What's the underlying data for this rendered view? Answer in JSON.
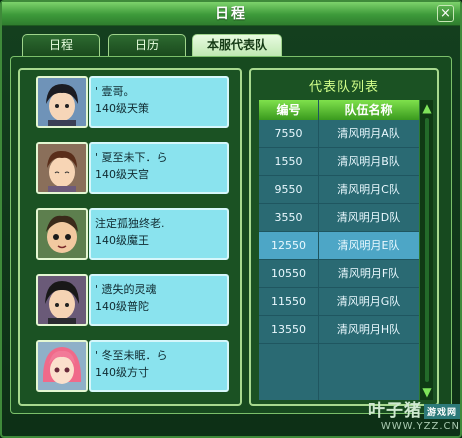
{
  "window": {
    "title": "日程",
    "close_glyph": "×"
  },
  "tabs": [
    {
      "label": "日程",
      "active": false
    },
    {
      "label": "日历",
      "active": false
    },
    {
      "label": "本服代表队",
      "active": true
    }
  ],
  "members": [
    {
      "name": "' 壹哥。",
      "level_class": "140级天策"
    },
    {
      "name": "' 夏至未下．ら",
      "level_class": "140级天宫"
    },
    {
      "name": "注定孤独终老.",
      "level_class": "140级魔王"
    },
    {
      "name": "' 遗失的灵魂",
      "level_class": "140级普陀"
    },
    {
      "name": "' 冬至未眠．ら",
      "level_class": "140级方寸"
    }
  ],
  "team_list": {
    "title": "代表队列表",
    "headers": {
      "id": "编号",
      "name": "队伍名称"
    },
    "rows": [
      {
        "id": "7550",
        "name": "清风明月A队",
        "selected": false
      },
      {
        "id": "1550",
        "name": "清风明月B队",
        "selected": false
      },
      {
        "id": "9550",
        "name": "清风明月C队",
        "selected": false
      },
      {
        "id": "3550",
        "name": "清风明月D队",
        "selected": false
      },
      {
        "id": "12550",
        "name": "清风明月E队",
        "selected": true
      },
      {
        "id": "10550",
        "name": "清风明月F队",
        "selected": false
      },
      {
        "id": "11550",
        "name": "清风明月G队",
        "selected": false
      },
      {
        "id": "13550",
        "name": "清风明月H队",
        "selected": false
      }
    ],
    "scroll_up_glyph": "▲",
    "scroll_down_glyph": "▼"
  },
  "watermark": {
    "name": "叶子猪",
    "badge": "游戏网",
    "url": "WWW.YZZ.CN"
  }
}
